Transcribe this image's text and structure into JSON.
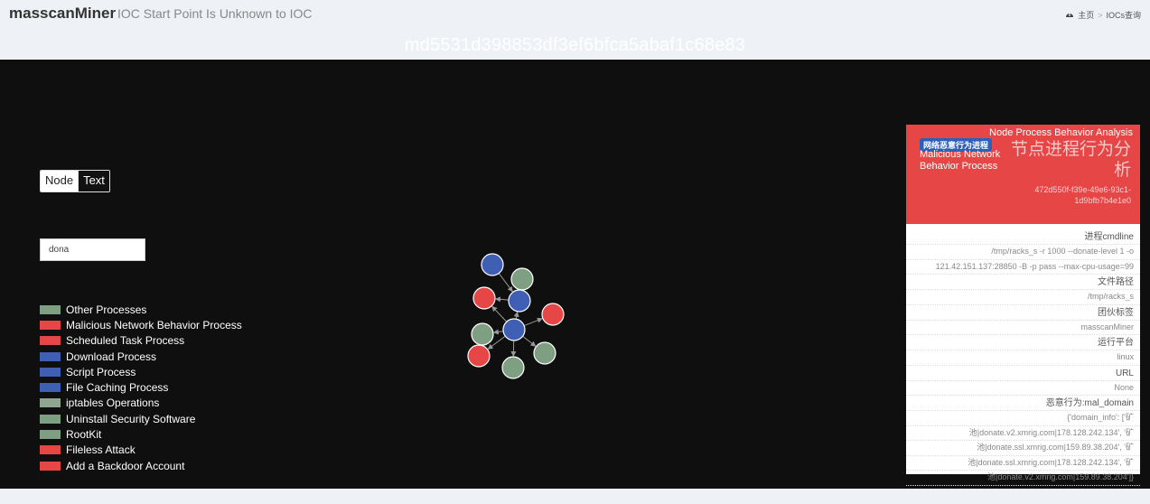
{
  "header": {
    "app_name": "masscanMiner",
    "page_subtitle": "IOC Start Point Is Unknown to IOC",
    "breadcrumb": {
      "home": "主页",
      "separator": ">",
      "current": "IOCs查询"
    },
    "hash_title": "md5531d398853df3ef6bfca5abaf1c68e83"
  },
  "toolbar": {
    "node_label": "Node",
    "text_label": "Text",
    "search_value": "dona"
  },
  "legend": [
    {
      "label": "Other Processes",
      "color": "#7f9f83"
    },
    {
      "label": "Malicious Network Behavior Process",
      "color": "#e64646"
    },
    {
      "label": "Scheduled Task Process",
      "color": "#e64646"
    },
    {
      "label": "Download Process",
      "color": "#3f5fb5"
    },
    {
      "label": "Script Process",
      "color": "#3f5fb5"
    },
    {
      "label": "File Caching Process",
      "color": "#3f5fb5"
    },
    {
      "label": "iptables Operations",
      "color": "#8fa592"
    },
    {
      "label": "Uninstall Security Software",
      "color": "#7f9f83"
    },
    {
      "label": "RootKit",
      "color": "#7f9f83"
    },
    {
      "label": "Fileless Attack",
      "color": "#e64646"
    },
    {
      "label": "Add a Backdoor Account",
      "color": "#e64646"
    }
  ],
  "panel": {
    "title": "Node Process Behavior Analysis",
    "badge": "网络恶意行为进程",
    "node_name": "Malicious Network Behavior Process",
    "big_title": "节点进程行为分析",
    "node_id": "472d550f-f39e-49e6-93c1-1d9bfb7b4e1e0",
    "rows": [
      {
        "label": "进程cmdline",
        "values": [
          "/tmp/racks_s -r 1000 --donate-level 1 -o",
          "121.42.151.137:28850 -B -p pass --max-cpu-usage=99"
        ]
      },
      {
        "label": "文件路径",
        "values": [
          "/tmp/racks_s"
        ]
      },
      {
        "label": "团伙标签",
        "values": [
          "masscanMiner"
        ]
      },
      {
        "label": "运行平台",
        "values": [
          "linux"
        ]
      },
      {
        "label": "URL",
        "values": [
          "None"
        ]
      },
      {
        "label": "恶意行为:mal_domain",
        "values": [
          "{'domain_info': ['矿",
          "池|donate.v2.xmrig.com|178.128.242.134', '矿",
          "池|donate.ssl.xmrig.com|159.89.38.204', '矿",
          "池|donate.ssl.xmrig.com|178.128.242.134', '矿",
          "池|donate.v2.xmrig.com|159.89.38.204']}"
        ]
      }
    ]
  },
  "graph": {
    "nodes": [
      {
        "id": "n1",
        "color": "#3f5fb5"
      },
      {
        "id": "n2",
        "color": "#7f9f83"
      },
      {
        "id": "n3",
        "color": "#e64646"
      },
      {
        "id": "n4",
        "color": "#3f5fb5"
      },
      {
        "id": "n5",
        "color": "#e64646"
      },
      {
        "id": "n6",
        "color": "#3f5fb5"
      },
      {
        "id": "n7",
        "color": "#7f9f83"
      },
      {
        "id": "n8",
        "color": "#e64646"
      },
      {
        "id": "n9",
        "color": "#7f9f83"
      },
      {
        "id": "n10",
        "color": "#7f9f83"
      }
    ]
  }
}
